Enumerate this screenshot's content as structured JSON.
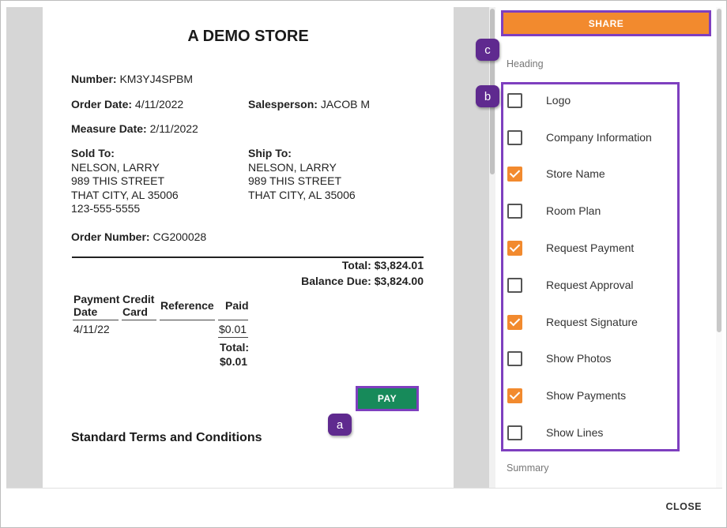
{
  "document": {
    "store_name": "A DEMO STORE",
    "number_label": "Number:",
    "number_value": "KM3YJ4SPBM",
    "order_date_label": "Order Date:",
    "order_date_value": "4/11/2022",
    "salesperson_label": "Salesperson:",
    "salesperson_value": "JACOB M",
    "measure_date_label": "Measure Date:",
    "measure_date_value": "2/11/2022",
    "sold_to": {
      "heading": "Sold To:",
      "name": "NELSON, LARRY",
      "street": "989 THIS STREET",
      "city": "THAT CITY, AL 35006",
      "phone": "123-555-5555"
    },
    "ship_to": {
      "heading": "Ship To:",
      "name": "NELSON, LARRY",
      "street": "989 THIS STREET",
      "city": "THAT CITY, AL 35006"
    },
    "order_number_label": "Order Number:",
    "order_number_value": "CG200028",
    "total_text": "Total: $3,824.01",
    "balance_due_text": "Balance Due: $3,824.00",
    "payments_table": {
      "headers": {
        "payment_date_1": "Payment",
        "payment_date_2": "Date",
        "credit_card_1": "Credit",
        "credit_card_2": "Card",
        "reference": "Reference",
        "paid": "Paid"
      },
      "row": {
        "date": "4/11/22",
        "paid": "$0.01"
      },
      "total_label": "Total:",
      "total_value": "$0.01"
    },
    "pay_button": "PAY",
    "terms_heading": "Standard Terms and Conditions"
  },
  "panel": {
    "share_button": "SHARE",
    "heading_section": "Heading",
    "summary_section": "Summary",
    "options": [
      {
        "label": "Logo",
        "checked": false
      },
      {
        "label": "Company Information",
        "checked": false
      },
      {
        "label": "Store Name",
        "checked": true
      },
      {
        "label": "Room Plan",
        "checked": false
      },
      {
        "label": "Request Payment",
        "checked": true
      },
      {
        "label": "Request Approval",
        "checked": false
      },
      {
        "label": "Request Signature",
        "checked": true
      },
      {
        "label": "Show Photos",
        "checked": false
      },
      {
        "label": "Show Payments",
        "checked": true
      },
      {
        "label": "Show Lines",
        "checked": false
      }
    ]
  },
  "callouts": {
    "a": "a",
    "b": "b",
    "c": "c"
  },
  "footer": {
    "close_button": "CLOSE"
  },
  "colors": {
    "accent_orange": "#f28a2e",
    "pay_green": "#178a5a",
    "callout_purple": "#5f2a8f",
    "highlight_border": "#7e3fbf"
  }
}
